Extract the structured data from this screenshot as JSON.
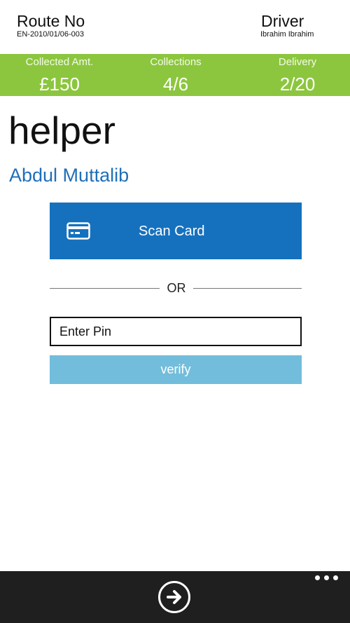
{
  "header": {
    "route_title": "Route No",
    "route_number": "EN-2010/01/06-003",
    "driver_title": "Driver",
    "driver_name": "Ibrahim Ibrahim"
  },
  "stats": {
    "collected_amount_label": "Collected Amt.",
    "collected_amount_value": "£150",
    "collections_label": "Collections",
    "collections_value": "4/6",
    "delivery_label": "Delivery",
    "delivery_value": "2/20"
  },
  "main": {
    "title": "helper",
    "person_name": "Abdul Muttalib",
    "scan_card_label": "Scan Card",
    "or_label": "OR",
    "pin_placeholder": "Enter Pin",
    "verify_label": "verify"
  },
  "app_bar": {
    "icons": [
      "arrow-right-icon",
      "more-icon"
    ]
  },
  "colors": {
    "stats_bar": "#8cc63e",
    "accent_blue": "#1571be",
    "verify_button": "#72bddb",
    "name_blue": "#1f6fba",
    "app_bar": "#1f1f1f"
  }
}
